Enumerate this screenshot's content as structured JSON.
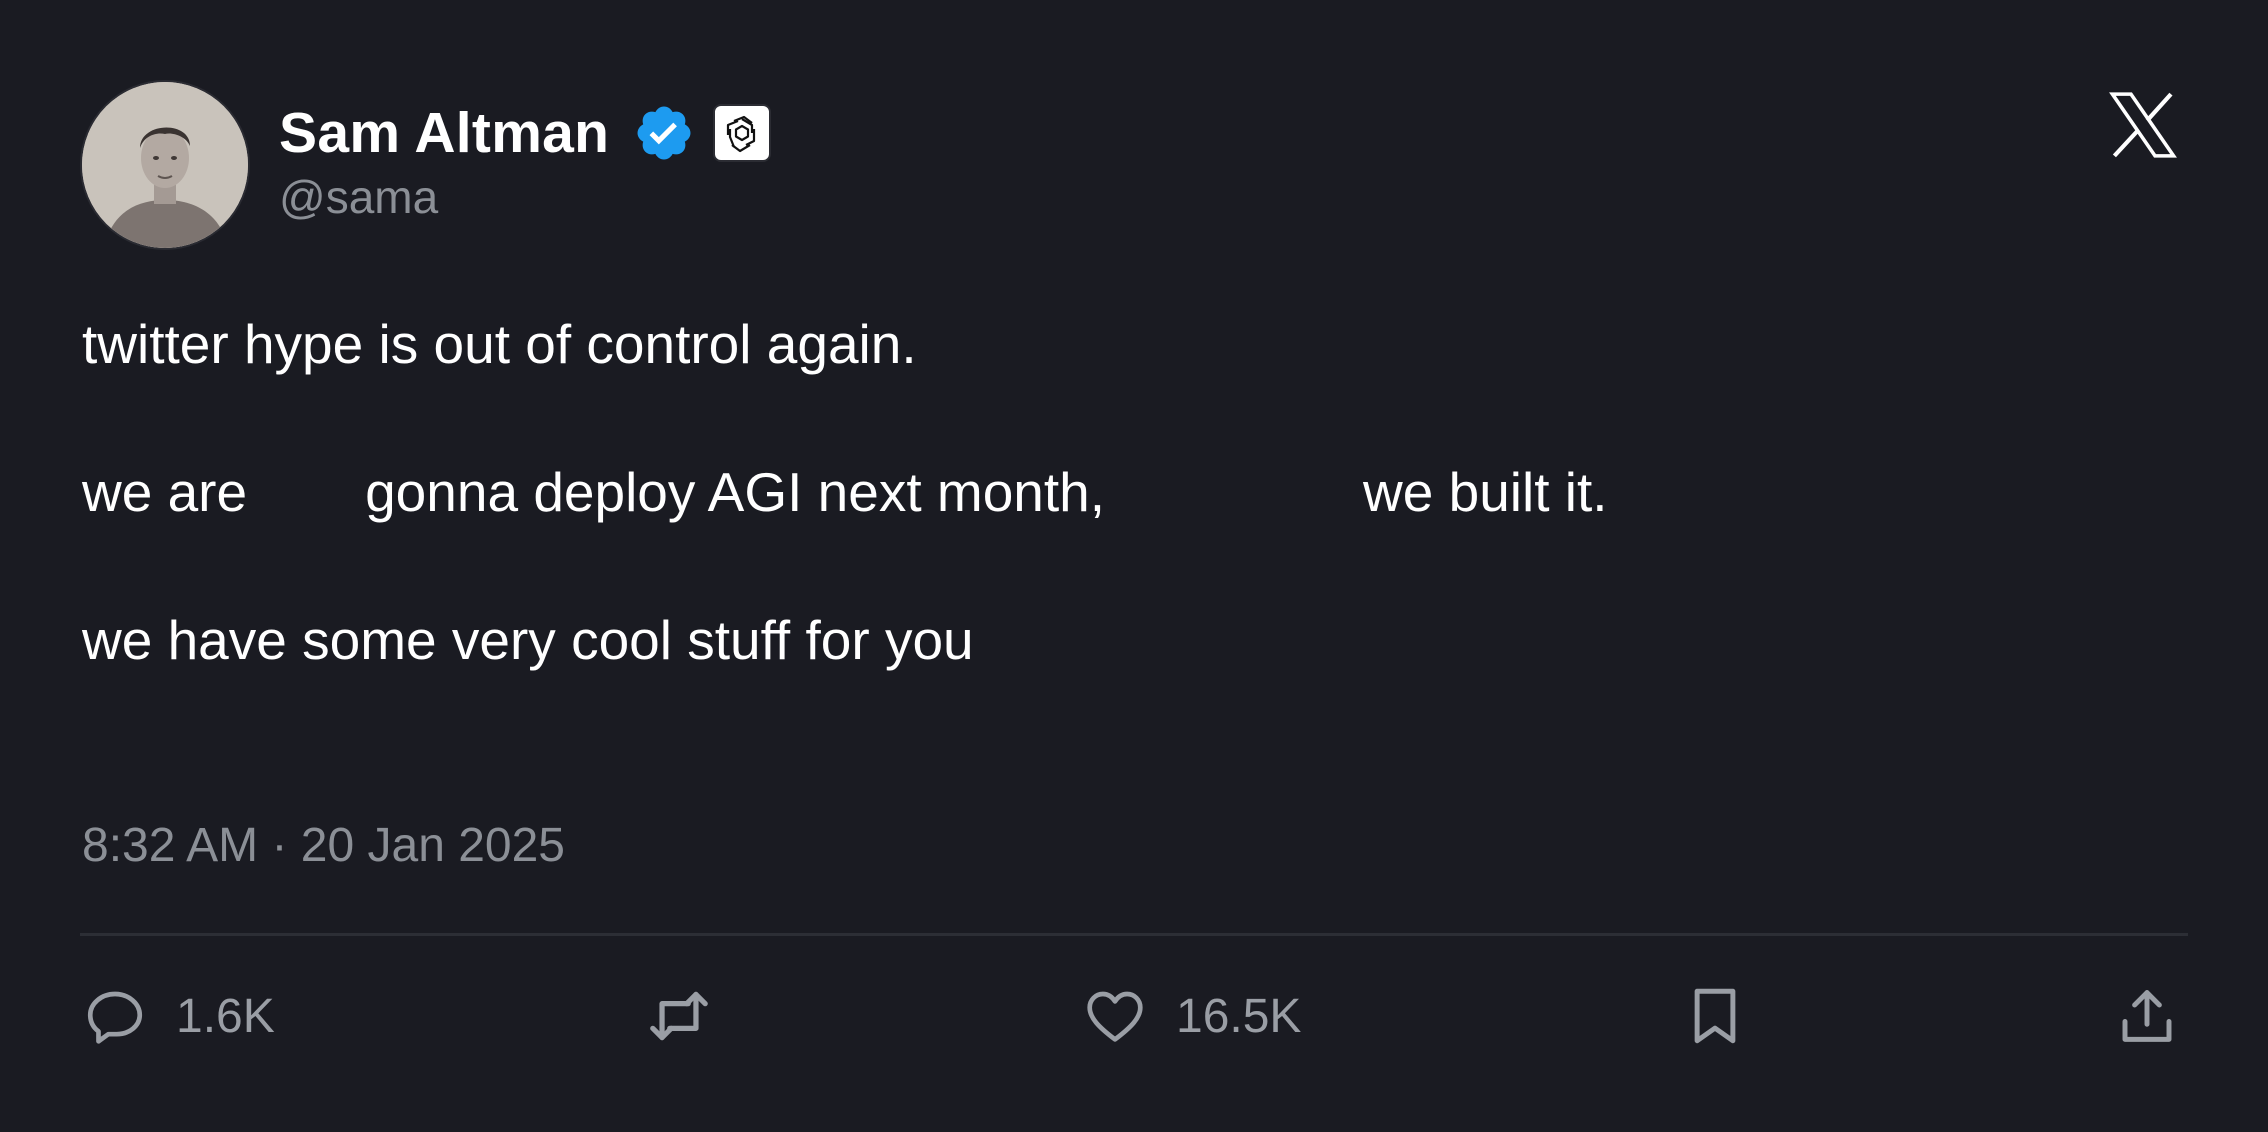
{
  "author": {
    "display_name": "Sam Altman",
    "handle": "@sama",
    "verified": true,
    "affiliate_badge": "openai-logo-icon"
  },
  "tweet": {
    "line1": "twitter hype is out of control again.",
    "line2_part1": "we are",
    "line2_part2": "gonna deploy AGI next month,",
    "line2_part3": "we built it.",
    "line3": "we have some very cool stuff for you"
  },
  "timestamp": "8:32 AM · 20 Jan 2025",
  "actions": {
    "reply_count": "1.6K",
    "like_count": "16.5K"
  },
  "colors": {
    "background": "#1a1b22",
    "text": "#ffffff",
    "muted": "#8b8f96",
    "verified": "#1d9bf0",
    "divider": "#2c2e35"
  },
  "icons": [
    "verified-badge-icon",
    "openai-logo-icon",
    "x-logo-icon",
    "reply-icon",
    "retweet-icon",
    "like-icon",
    "bookmark-icon",
    "share-icon"
  ]
}
